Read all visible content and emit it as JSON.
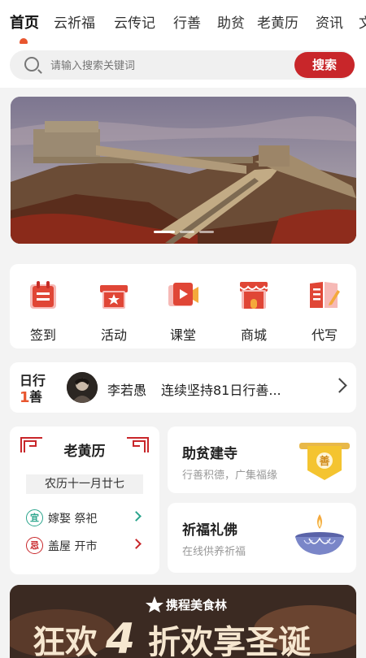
{
  "tabs": [
    "首页",
    "云祈福",
    "云传记",
    "行善",
    "助贫",
    "老黄历",
    "资讯",
    "文"
  ],
  "search": {
    "placeholder": "请输入搜索关键词",
    "button": "搜索"
  },
  "menu": [
    {
      "label": "签到",
      "icon": "calendar-icon"
    },
    {
      "label": "活动",
      "icon": "gift-box-icon"
    },
    {
      "label": "课堂",
      "icon": "video-play-icon"
    },
    {
      "label": "商城",
      "icon": "shop-icon"
    },
    {
      "label": "代写",
      "icon": "write-book-icon"
    }
  ],
  "good_deeds": {
    "logo_top": "日行",
    "logo_bottom": "善",
    "logo_number": "1",
    "name": "李若愚",
    "text": "连续坚持81日行善..."
  },
  "almanac": {
    "title": "老黄历",
    "lunar_date": "农历十一月廿七",
    "yi_badge": "宜",
    "yi_text": "嫁娶 祭祀",
    "ji_badge": "忌",
    "ji_text": "盖屋 开市"
  },
  "poverty": {
    "title": "助贫建寺",
    "subtitle": "行善积德，广集福缘",
    "badge": "善"
  },
  "prayer": {
    "title": "祈福礼佛",
    "subtitle": "在线供养祈福"
  },
  "promo": {
    "brand": "携程美食林",
    "headline_1": "狂欢",
    "headline_num": "4",
    "headline_2": "折欢享圣诞"
  },
  "colors": {
    "accent": "#c8262a",
    "orange": "#e8562f",
    "gold": "#f2c230"
  }
}
